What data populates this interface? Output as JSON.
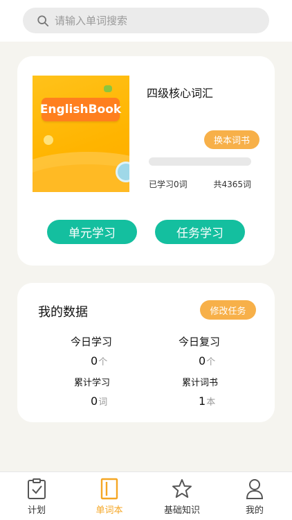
{
  "search": {
    "placeholder": "请输入单词搜索"
  },
  "book": {
    "cover_text": "EnglishBook",
    "title": "四级核心词汇",
    "switch_label": "换本词书",
    "progress": 0,
    "learned_text": "已学习0词",
    "total_text": "共4365词",
    "unit_study_label": "单元学习",
    "task_study_label": "任务学习"
  },
  "my_data": {
    "title": "我的数据",
    "edit_label": "修改任务",
    "stats": [
      {
        "label": "今日学习",
        "value": "0",
        "unit": "个"
      },
      {
        "label": "今日复习",
        "value": "0",
        "unit": "个"
      },
      {
        "label": "累计学习",
        "value": "0",
        "unit": "词"
      },
      {
        "label": "累计词书",
        "value": "1",
        "unit": "本"
      }
    ]
  },
  "tabs": [
    {
      "label": "计划",
      "icon": "clipboard-check-icon",
      "active": false
    },
    {
      "label": "单词本",
      "icon": "book-icon",
      "active": true
    },
    {
      "label": "基础知识",
      "icon": "star-icon",
      "active": false
    },
    {
      "label": "我的",
      "icon": "user-icon",
      "active": false
    }
  ],
  "colors": {
    "accent": "#14bf9f",
    "orange": "#f7b049",
    "tab_active": "#f5a623"
  }
}
